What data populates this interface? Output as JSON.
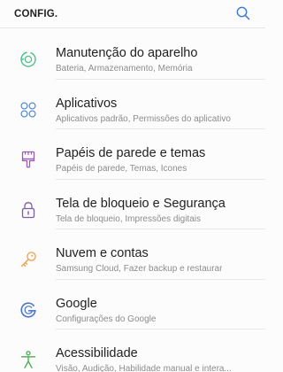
{
  "header": {
    "title": "CONFIG.",
    "search_icon": "search-icon"
  },
  "colors": {
    "maintenance": "#4fc08d",
    "apps": "#5b8dd6",
    "wallpapers": "#9b59b6",
    "lockscreen": "#7b5ea7",
    "cloud": "#f0a04b",
    "google": "#4b76d0",
    "accessibility": "#4caf50",
    "search": "#3a7bd5"
  },
  "settings": {
    "items": [
      {
        "title": "Manutenção do aparelho",
        "subtitle": "Bateria, Armazenamento, Memória",
        "icon": "device-maintenance-icon"
      },
      {
        "title": "Aplicativos",
        "subtitle": "Aplicativos padrão, Permissões do aplicativo",
        "icon": "apps-icon"
      },
      {
        "title": "Papéis de parede e temas",
        "subtitle": "Papéis de parede, Temas, Ícones",
        "icon": "paint-brush-icon"
      },
      {
        "title": "Tela de bloqueio e Segurança",
        "subtitle": "Tela de bloqueio, Impressões digitais",
        "icon": "lock-icon"
      },
      {
        "title": "Nuvem e contas",
        "subtitle": "Samsung Cloud, Fazer backup e restaurar",
        "icon": "key-icon"
      },
      {
        "title": "Google",
        "subtitle": "Configurações do Google",
        "icon": "google-icon"
      },
      {
        "title": "Acessibilidade",
        "subtitle": "Visão, Audição, Habilidade manual e intera...",
        "icon": "accessibility-icon"
      }
    ]
  }
}
